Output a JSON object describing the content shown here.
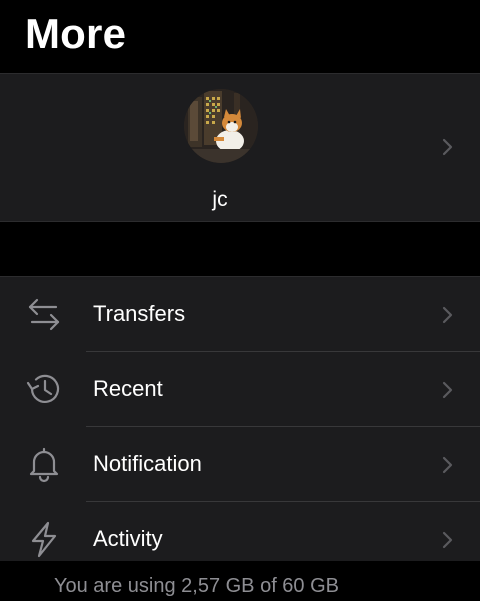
{
  "header": {
    "title": "More"
  },
  "profile": {
    "name": "jc"
  },
  "menu": [
    {
      "label": "Transfers",
      "icon": "transfers-icon"
    },
    {
      "label": "Recent",
      "icon": "recent-history-icon"
    },
    {
      "label": "Notification",
      "icon": "bell-icon"
    },
    {
      "label": "Activity",
      "icon": "lightning-icon"
    }
  ],
  "storage": {
    "text": "You are using 2,57 GB of 60 GB"
  },
  "colors": {
    "background": "#000000",
    "cell": "#1c1c1e",
    "separator": "#38383a",
    "secondary_text": "#8e8e93",
    "icon": "#8e8e93",
    "chevron": "#5a5a5e"
  }
}
